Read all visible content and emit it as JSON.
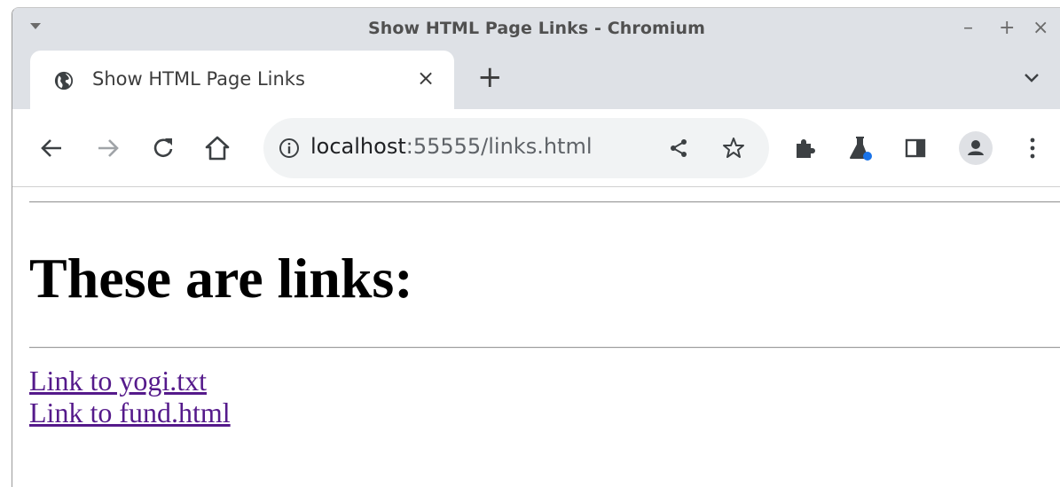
{
  "window": {
    "title": "Show HTML Page Links - Chromium",
    "controls": {
      "minimize": "–",
      "maximize": "+",
      "close": "×"
    }
  },
  "tabs": [
    {
      "title": "Show HTML Page Links",
      "close": "×",
      "icon": "globe-icon"
    }
  ],
  "tabstrip": {
    "new_tab": "+"
  },
  "toolbar": {
    "url_host": "localhost",
    "url_rest": ":55555/links.html",
    "icons": [
      "back-icon",
      "forward-icon",
      "reload-icon",
      "home-icon",
      "info-icon",
      "share-icon",
      "bookmark-star-icon",
      "extensions-icon",
      "labs-flask-icon",
      "side-panel-icon",
      "profile-avatar-icon",
      "menu-kebab-icon"
    ]
  },
  "page": {
    "heading": "These are links:",
    "links": [
      {
        "text": "Link to yogi.txt"
      },
      {
        "text": "Link to fund.html"
      }
    ],
    "link_color": "#551a8b"
  },
  "colors": {
    "chrome_bg": "#dee1e6",
    "omnibox_bg": "#f1f3f4",
    "profile_dot": "#1a73e8"
  }
}
